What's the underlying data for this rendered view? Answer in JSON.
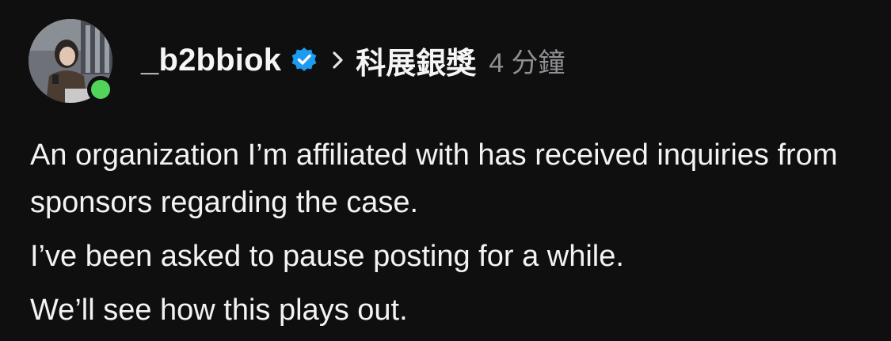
{
  "post": {
    "author": {
      "username": "_b2bbiok",
      "verified_icon": "verified-badge-icon",
      "online": true,
      "avatar_icon": "avatar-photo"
    },
    "community": {
      "separator_icon": "chevron-right-icon",
      "name": "科展銀獎"
    },
    "timestamp": "4 分鐘",
    "paragraphs": [
      "An organization I’m affiliated with has received inquiries from sponsors regarding the case.",
      "I’ve been asked to pause posting for a while.",
      "We’ll see how this plays out."
    ]
  },
  "colors": {
    "background": "#0f0f0f",
    "text": "#f3f3f3",
    "muted": "#8e8e93",
    "verified_blue": "#1d9bf0",
    "online_green": "#52d35a"
  }
}
